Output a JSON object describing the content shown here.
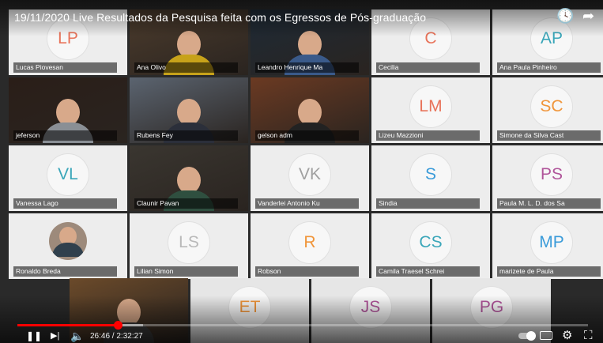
{
  "video": {
    "title": "19/11/2020 Live Resultados da Pesquisa feita com os Egressos de Pós-graduação",
    "current_time": "26:46",
    "duration": "2:32:27",
    "progress_fraction": 0.176,
    "buffered_fraction": 0.22,
    "colors": {
      "progress": "#ff0000",
      "title": "#ffffff"
    }
  },
  "icons": {
    "watch_later": "clock-icon",
    "share": "share-arrow-icon",
    "play_pause": "pause-icon",
    "next": "next-icon",
    "volume": "volume-icon",
    "captions": "captions-icon",
    "settings": "gear-icon",
    "fullscreen": "fullscreen-exit-icon"
  },
  "glyphs": {
    "clock": "🕓",
    "share": "➦",
    "pause": "❚❚",
    "next": "▶|",
    "volume": "🔈",
    "gear": "⚙",
    "fullscreen": "⛶"
  },
  "participants": [
    {
      "name": "Lucas Piovesan",
      "initials": "LP",
      "color": "#e8735a",
      "type": "initials"
    },
    {
      "name": "Ana Olivo",
      "initials": "",
      "color": "",
      "type": "video",
      "bg": "#4b3b2c",
      "shirt": "#c7a21a"
    },
    {
      "name": "Leandro Henrique Ma",
      "initials": "",
      "color": "",
      "type": "video",
      "bg": "#1e2a36",
      "shirt": "#3a5a8a"
    },
    {
      "name": "Cecilia",
      "initials": "C",
      "color": "#e8735a",
      "type": "initials"
    },
    {
      "name": "Ana Paula Pinheiro",
      "initials": "AP",
      "color": "#3aa6b9",
      "type": "initials"
    },
    {
      "name": "jeferson",
      "initials": "",
      "color": "",
      "type": "video",
      "bg": "#2a1e18",
      "shirt": "#8a8f95"
    },
    {
      "name": "Rubens Fey",
      "initials": "",
      "color": "",
      "type": "video",
      "bg": "#5b6470",
      "shirt": "#2b2f3a"
    },
    {
      "name": "gelson adm",
      "initials": "",
      "color": "",
      "type": "video",
      "bg": "#6b3a22",
      "shirt": "#222222"
    },
    {
      "name": "Lizeu Mazzioni",
      "initials": "LM",
      "color": "#e8735a",
      "type": "initials"
    },
    {
      "name": "Simone da Silva Cast",
      "initials": "SC",
      "color": "#f0953a",
      "type": "initials"
    },
    {
      "name": "Vanessa Lago",
      "initials": "VL",
      "color": "#3aa6b9",
      "type": "initials"
    },
    {
      "name": "Claunir Pavan",
      "initials": "",
      "color": "",
      "type": "video",
      "bg": "#3a3630",
      "shirt": "#2f4f3f"
    },
    {
      "name": "Vanderlei Antonio Ku",
      "initials": "VK",
      "color": "#a0a0a0",
      "type": "initials"
    },
    {
      "name": "Sindia",
      "initials": "S",
      "color": "#3a9bd9",
      "type": "initials"
    },
    {
      "name": "Paula M. L. D. dos Sa",
      "initials": "PS",
      "color": "#b0559a",
      "type": "initials"
    },
    {
      "name": "Ronaldo Breda",
      "initials": "",
      "color": "",
      "type": "photo"
    },
    {
      "name": "Lilian Simon",
      "initials": "LS",
      "color": "#b9b9b9",
      "type": "initials"
    },
    {
      "name": "Robson",
      "initials": "R",
      "color": "#f0953a",
      "type": "initials"
    },
    {
      "name": "Camila Traesel Schrei",
      "initials": "CS",
      "color": "#3aa6b9",
      "type": "initials"
    },
    {
      "name": "marizete de Paula",
      "initials": "MP",
      "color": "#3a9bd9",
      "type": "initials"
    }
  ],
  "bottom_row": [
    {
      "name": "",
      "initials": "",
      "color": "",
      "type": "video",
      "bg": "#6b4a2a",
      "shirt": "#3a3a3a"
    },
    {
      "name": "",
      "initials": "ET",
      "color": "#f0953a",
      "type": "initials"
    },
    {
      "name": "",
      "initials": "JS",
      "color": "#b0559a",
      "type": "initials"
    },
    {
      "name": "",
      "initials": "PG",
      "color": "#b0559a",
      "type": "initials"
    }
  ]
}
